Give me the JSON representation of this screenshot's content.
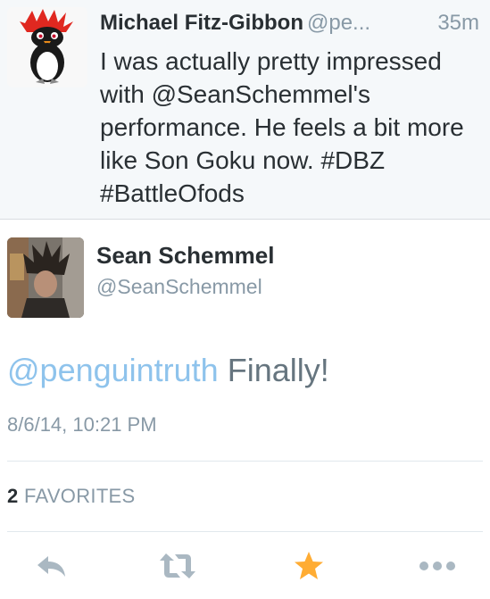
{
  "parent_tweet": {
    "name": "Michael Fitz-Gibbon",
    "handle": "@pe...",
    "time": "35m",
    "text": "I was actually pretty impressed with @SeanSchemmel's performance. He feels a bit more like Son Goku now. #DBZ #BattleOfods"
  },
  "tweet": {
    "author_name": "Sean Schemmel",
    "author_handle": "@SeanSchemmel",
    "mention": "@penguintruth",
    "text": " Finally!",
    "date": "8/6/14, 10:21 PM",
    "favorites_count": "2",
    "favorites_label": "FAVORITES"
  },
  "actions": {
    "reply_icon": "reply-icon",
    "retweet_icon": "retweet-icon",
    "favorite_icon": "star-icon",
    "more_icon": "more-icon"
  },
  "colors": {
    "accent_blue": "#8ec3ec",
    "muted_grey": "#8899a6",
    "icon_grey": "#aab8c2",
    "favorite_orange": "#ffac33",
    "parent_bg": "#f5f8fa"
  }
}
